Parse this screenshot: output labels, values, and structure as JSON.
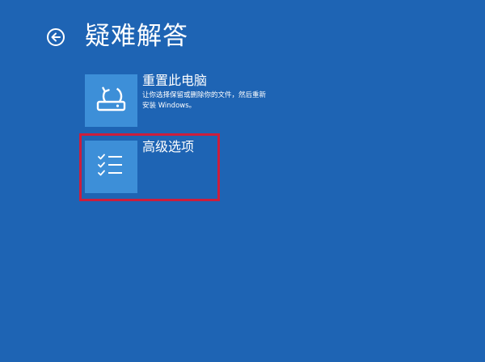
{
  "screen": {
    "title": "疑难解答",
    "back_icon": "back-arrow-circle-icon"
  },
  "options": [
    {
      "id": "reset",
      "title": "重置此电脑",
      "description": "让你选择保留或删除你的文件，然后重新安装 Windows。",
      "icon": "refresh-drive-icon"
    },
    {
      "id": "advanced",
      "title": "高级选项",
      "description": "",
      "icon": "checklist-icon",
      "highlighted": true
    }
  ],
  "colors": {
    "background": "#1e64b4",
    "tile": "#3d8fd8",
    "highlight": "#cc1e3c",
    "text": "#ffffff"
  }
}
